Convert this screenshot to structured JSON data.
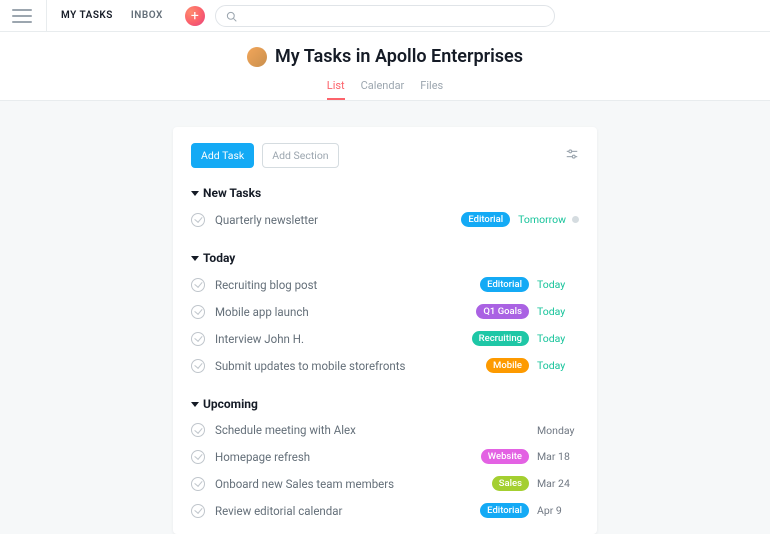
{
  "topbar": {
    "nav": {
      "mytasks": "MY TASKS",
      "inbox": "INBOX"
    },
    "search_placeholder": ""
  },
  "header": {
    "title": "My Tasks in Apollo Enterprises",
    "tabs": {
      "list": "List",
      "calendar": "Calendar",
      "files": "Files"
    }
  },
  "actions": {
    "add_task": "Add Task",
    "add_section": "Add Section"
  },
  "sections": {
    "new_tasks": {
      "title": "New Tasks",
      "items": [
        {
          "title": "Quarterly newsletter",
          "tag": "Editorial",
          "tag_color": "#14aaf5",
          "date": "Tomorrow",
          "soon": true,
          "dot": true
        }
      ]
    },
    "today": {
      "title": "Today",
      "items": [
        {
          "title": "Recruiting blog post",
          "tag": "Editorial",
          "tag_color": "#14aaf5",
          "date": "Today",
          "soon": true
        },
        {
          "title": "Mobile app launch",
          "tag": "Q1 Goals",
          "tag_color": "#aa62e3",
          "date": "Today",
          "soon": true
        },
        {
          "title": "Interview John H.",
          "tag": "Recruiting",
          "tag_color": "#1ec7a6",
          "date": "Today",
          "soon": true
        },
        {
          "title": "Submit updates to mobile storefronts",
          "tag": "Mobile",
          "tag_color": "#fd9a00",
          "date": "Today",
          "soon": true
        }
      ]
    },
    "upcoming": {
      "title": "Upcoming",
      "items": [
        {
          "title": "Schedule meeting with Alex",
          "date": "Monday"
        },
        {
          "title": "Homepage refresh",
          "tag": "Website",
          "tag_color": "#e362e3",
          "date": "Mar 18"
        },
        {
          "title": "Onboard new Sales team members",
          "tag": "Sales",
          "tag_color": "#a4cf30",
          "date": "Mar 24"
        },
        {
          "title": "Review editorial calendar",
          "tag": "Editorial",
          "tag_color": "#14aaf5",
          "date": "Apr 9"
        }
      ]
    }
  }
}
